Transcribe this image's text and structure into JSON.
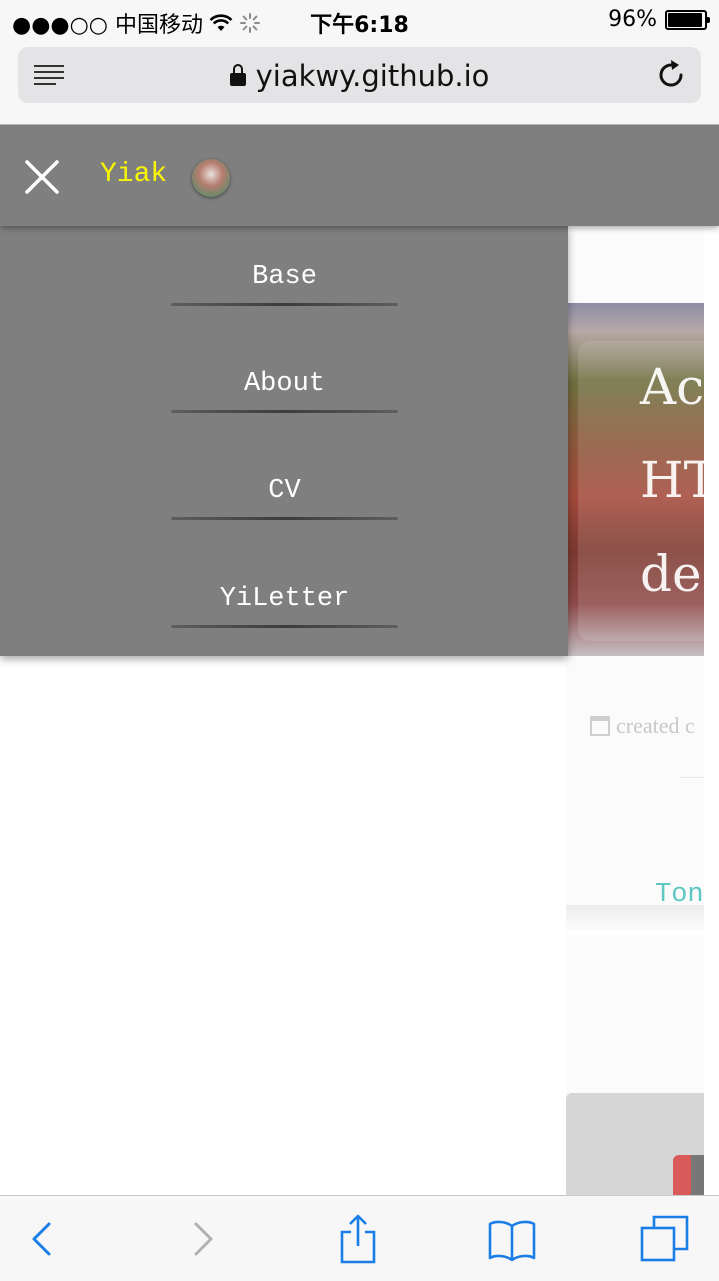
{
  "status_bar": {
    "carrier": "●●●○○ 中国移动",
    "time": "下午6:18",
    "battery": "96%"
  },
  "browser": {
    "url": "yiakwy.github.io"
  },
  "site": {
    "brand": "Yiak",
    "menu": [
      {
        "label": "Base"
      },
      {
        "label": "About"
      },
      {
        "label": "CV"
      },
      {
        "label": "YiLetter"
      }
    ],
    "hero_lines": [
      "Ac",
      "HT",
      "de"
    ],
    "meta_text": "created c",
    "link_text": "Ton"
  },
  "colors": {
    "nav_bg": "#7f7f7f",
    "brand": "#f8f700",
    "link": "#5fc7c1",
    "ios_blue": "#1a7ee6"
  },
  "icons": [
    "reader-icon",
    "lock-icon",
    "reload-icon",
    "wifi-icon",
    "loading-icon",
    "close-icon",
    "calendar-icon",
    "back-icon",
    "forward-icon",
    "share-icon",
    "bookmarks-icon",
    "tabs-icon"
  ]
}
